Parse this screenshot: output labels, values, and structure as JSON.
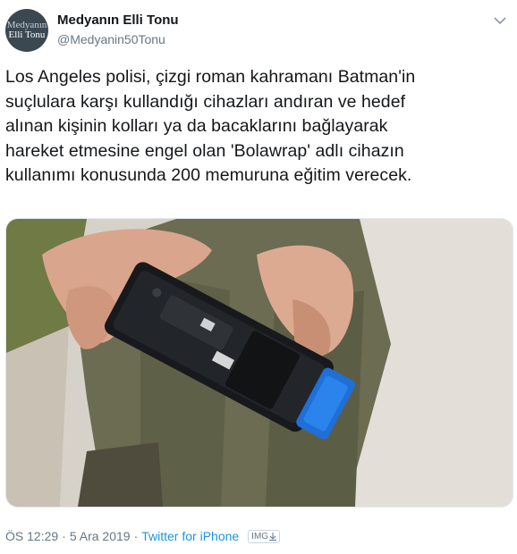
{
  "user": {
    "display_name": "Medyanın Elli Tonu",
    "handle": "@Medyanin50Tonu",
    "avatar_line1": "Medyanın",
    "avatar_line2": "Elli Tonu"
  },
  "tweet": {
    "lines": [
      "Los Angeles polisi, çizgi roman kahramanı Batman'in",
      "suçlulara karşı kullandığı cihazları andıran ve hedef",
      "alınan kişinin kolları ya da bacaklarını bağlayarak",
      "hareket etmesine engel olan 'Bolawrap' adlı cihazın",
      "kullanımı konusunda 200 memuruna eğitim verecek."
    ]
  },
  "meta": {
    "time": "ÖS 12:29",
    "separator1": "·",
    "date": "5 Ara 2019",
    "separator2": "·",
    "source": "Twitter for iPhone",
    "badge": "IMG"
  },
  "icons": {
    "menu": "chevron-down-icon"
  },
  "colors": {
    "link": "#1b95e0",
    "secondary": "#657786",
    "device_accent": "#1f6fd6"
  }
}
